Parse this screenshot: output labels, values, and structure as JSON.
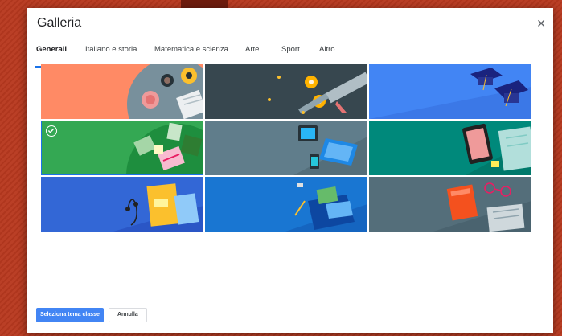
{
  "dialog": {
    "title": "Galleria",
    "close_icon": "close-icon"
  },
  "tabs": [
    {
      "label": "Generali",
      "active": true
    },
    {
      "label": "Italiano e storia",
      "active": false
    },
    {
      "label": "Matematica e scienza",
      "active": false
    },
    {
      "label": "Arte",
      "active": false
    },
    {
      "label": "Sport",
      "active": false
    },
    {
      "label": "Altro",
      "active": false
    }
  ],
  "themes": [
    {
      "name": "coffee-breakfast-theme",
      "color": "#ff8a65",
      "selected": false
    },
    {
      "name": "diploma-theme",
      "color": "#37474f",
      "selected": false
    },
    {
      "name": "graduation-caps-theme",
      "color": "#4285f4",
      "selected": false
    },
    {
      "name": "study-books-theme",
      "color": "#34a853",
      "selected": true
    },
    {
      "name": "laptop-tablet-theme",
      "color": "#607d8b",
      "selected": false
    },
    {
      "name": "phone-notes-theme",
      "color": "#00897b",
      "selected": false
    },
    {
      "name": "headphones-notebook-theme",
      "color": "#3367d6",
      "selected": false
    },
    {
      "name": "backpack-theme",
      "color": "#1976d2",
      "selected": false
    },
    {
      "name": "book-glasses-theme",
      "color": "#546e7a",
      "selected": false
    }
  ],
  "footer": {
    "select_label": "Seleziona tema classe",
    "cancel_label": "Annulla"
  },
  "colors": {
    "accent": "#1a73e8",
    "primary_button": "#4285f4",
    "backdrop": "#b8391f"
  }
}
